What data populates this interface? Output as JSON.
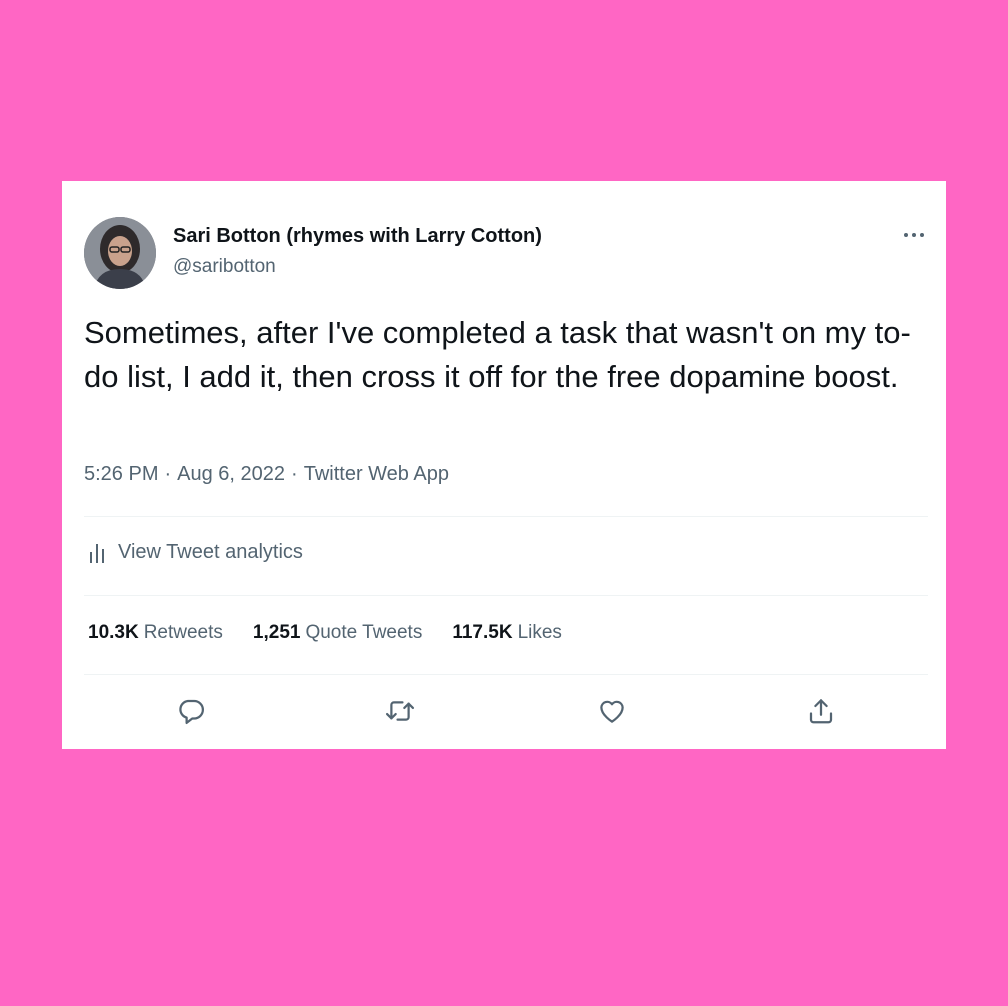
{
  "colors": {
    "background": "#ff66c4",
    "card": "#ffffff",
    "primary_text": "#0f1419",
    "secondary_text": "#536471"
  },
  "tweet": {
    "author": {
      "display_name": "Sari Botton (rhymes with Larry Cotton)",
      "handle": "@saribotton"
    },
    "text": "Sometimes, after I've completed a task that wasn't on my to-do list, I add it, then cross it off for the free dopamine boost.",
    "time": "5:26 PM",
    "date": "Aug 6, 2022",
    "source": "Twitter Web App",
    "separator": "·",
    "analytics_label": "View Tweet analytics",
    "stats": {
      "retweets_count": "10.3K",
      "retweets_label": "Retweets",
      "quote_tweets_count": "1,251",
      "quote_tweets_label": "Quote Tweets",
      "likes_count": "117.5K",
      "likes_label": "Likes"
    },
    "icons": {
      "more": "more-horizontal-icon",
      "analytics": "bar-chart-icon",
      "reply": "reply-bubble-icon",
      "retweet": "retweet-arrows-icon",
      "like": "heart-icon",
      "share": "share-upload-icon"
    }
  }
}
